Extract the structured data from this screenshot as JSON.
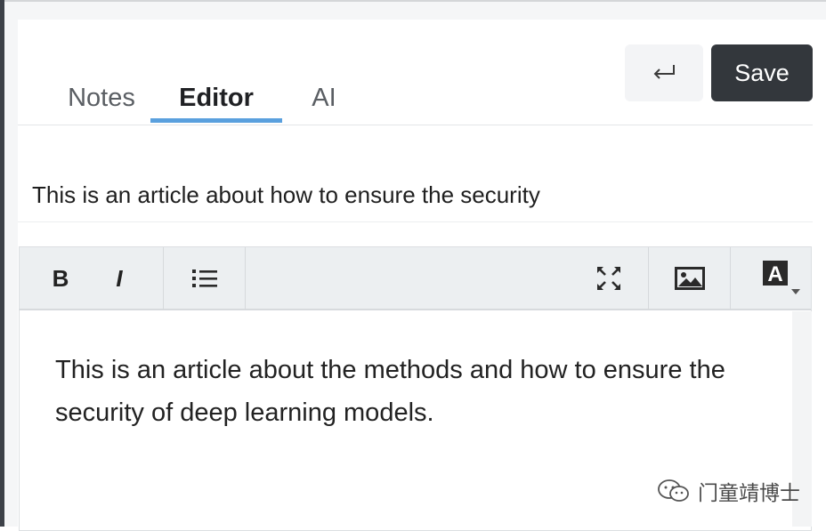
{
  "tabs": [
    {
      "label": "Notes",
      "active": false
    },
    {
      "label": "Editor",
      "active": true
    },
    {
      "label": "AI",
      "active": false
    }
  ],
  "actions": {
    "enter_icon": "return-icon",
    "save_label": "Save"
  },
  "editor": {
    "title": "This is an article about how to ensure the security",
    "body": "This is an article about the methods and how to ensure the security of deep learning models.",
    "toolbar": {
      "bold_label": "B",
      "italic_label": "I",
      "list_icon": "bulleted-list-icon",
      "fullscreen_icon": "fullscreen-icon",
      "image_icon": "image-icon",
      "font_icon": "font-color-icon",
      "font_label": "A"
    }
  },
  "watermark": {
    "text": "门童靖博士",
    "icon": "wechat-icon"
  },
  "colors": {
    "accent": "#5aa0de",
    "save_bg": "#33373c",
    "toolbar_bg": "#eceff1"
  }
}
